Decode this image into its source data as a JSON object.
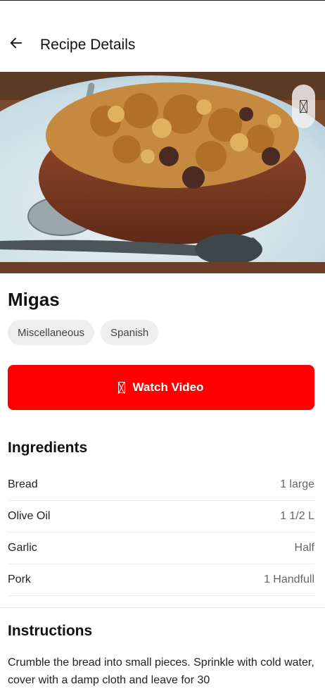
{
  "header": {
    "title": "Recipe Details"
  },
  "recipe": {
    "name": "Migas",
    "tags": [
      "Miscellaneous",
      "Spanish"
    ],
    "video_label": "Watch Video"
  },
  "ingredients": {
    "title": "Ingredients",
    "items": [
      {
        "name": "Bread",
        "qty": "1 large"
      },
      {
        "name": "Olive Oil",
        "qty": "1 1/2 L"
      },
      {
        "name": "Garlic",
        "qty": "Half"
      },
      {
        "name": "Pork",
        "qty": "1 Handfull"
      }
    ]
  },
  "instructions": {
    "title": "Instructions",
    "text": "Crumble the bread into small pieces. Sprinkle with cold water, cover with a damp cloth and leave for 30"
  },
  "colors": {
    "accent": "#ff0000",
    "chip_bg": "#eeeeee"
  },
  "icons": {
    "back": "arrow-left-icon",
    "favorite": "missing-glyph-icon",
    "video": "missing-glyph-icon"
  }
}
